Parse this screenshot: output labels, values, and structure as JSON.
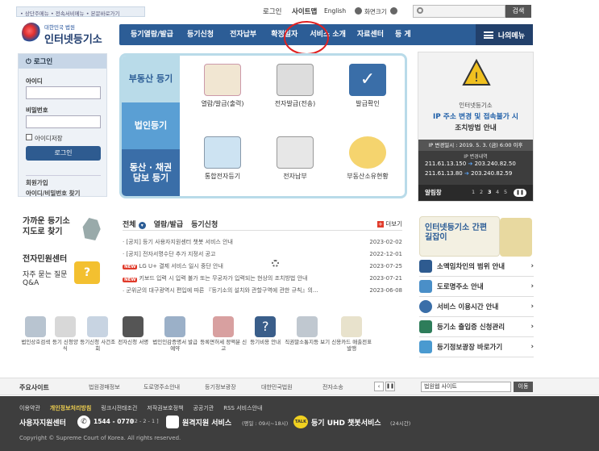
{
  "top_strip": "• 상단주메뉴  • 전속서비메뉴  • 본문바로가기",
  "utility": {
    "login": "로그인",
    "sitemap": "사이트맵",
    "english": "English",
    "zoom": "화면크기",
    "search_button": "검색"
  },
  "logo": {
    "court": "대한민국 법원",
    "name": "인터넷등기소"
  },
  "gnb": [
    "등기열람/발급",
    "등기신청",
    "전자납부",
    "확정일자",
    "서비스 소개",
    "자료센터",
    "등 게"
  ],
  "gnb_my": "나의메뉴",
  "login": {
    "title": "로그인",
    "id_label": "아이디",
    "pw_label": "비밀번호",
    "save_label": "아이디저장",
    "button": "로그인",
    "join": "회원가입",
    "find": "아이디/비밀번호 찾기"
  },
  "quick": {
    "label_realestate": "부동산 등기",
    "label_corp": "법인등기",
    "label_movable": "동산 · 채권 담보 등기",
    "items": [
      "열람/발급(출력)",
      "전자발급(전송)",
      "발급확인",
      "통합전자등기",
      "전자납부",
      "부동산소유현황"
    ]
  },
  "banner": {
    "brand": "인터넷등기소",
    "title1": "IP 주소 변경 및 접속불가 시",
    "title2": "조치방법 안내",
    "date": "IP 변경일시 : 2019. 5. 3. (금) 6:00 이후",
    "detail_label": "IP 변경내역",
    "row1_from": "211.61.13.150",
    "row1_to": "203.240.82.50",
    "row2_from": "211.61.13.80",
    "row2_to": "203.240.82.59",
    "alarm": "알림창",
    "pages": [
      "1",
      "2",
      "3",
      "4",
      "5"
    ]
  },
  "left_links": {
    "map_title": "가까운 등기소 지도로 찾기",
    "center_title": "전자민원센터",
    "qa": "자주 묻는 질문 Q&A"
  },
  "notice": {
    "tabs": [
      "전체",
      "열람/발급",
      "등기신청"
    ],
    "more": "더보기",
    "rows": [
      {
        "title": "[공지] 등기 사용자지원센터 챗봇 서비스 안내",
        "date": "2023-02-02",
        "new": ""
      },
      {
        "title": "[공지] 전자서명수단 추가 지정서 공고",
        "date": "2022-12-01",
        "new": ""
      },
      {
        "title": "LG U+ 결제 서비스 일시 중단 안내",
        "date": "2023-07-25",
        "new": "NEW"
      },
      {
        "title": "키보드 입력 시 입력 불가 또는 무궁자가 입력되는 현상의 조치방법 안내",
        "date": "2023-07-21",
        "new": "NEW"
      },
      {
        "title": "군위군의 대구광역시 편입에 따른 『등기소의 설치와 관할구역에 관한 규칙』의...",
        "date": "2023-06-08",
        "new": ""
      }
    ]
  },
  "svc": {
    "banner_title": "인터넷등기소 간편길잡이",
    "items": [
      "소액임차인의 범위 안내",
      "도로명주소 안내",
      "서비스 이용시간 안내",
      "등기소 출입증 신청관리",
      "등기정보광장 바로가기"
    ]
  },
  "icons": [
    "법인상호검색",
    "등기 신청양식",
    "등기신청 사건조회",
    "전자신청 서명",
    "법인인감증명서 발급예약",
    "등록면허세 정액분 신고",
    "등기비용 안내",
    "직권말소통지등 보기",
    "신용카드 매출전표 발행"
  ],
  "sitebar": {
    "label": "주요사이트",
    "sites": [
      "법원경매정보",
      "도로명주소안내",
      "등기정보광장",
      "대한민국법원",
      "전자소송"
    ],
    "select": "법원웹 사이트",
    "go": "이동"
  },
  "footer": {
    "links": [
      "이용약관",
      "개인정보처리방침",
      "링크시전태조건",
      "저작권보호정책",
      "공공기관",
      "RSS 서비스안내"
    ],
    "center": "사용자지원센터",
    "phone": "1544 - 0770",
    "phone_sub": "[ 82 - 2 - 1 ]",
    "remote": "원격지원 서비스",
    "remote_sub": "(평일 : 09시~18시)",
    "chat": "등기 UHD 챗봇서비스",
    "chat_sub": "(24시간)",
    "copyright": "Copyright © Supreme Court of Korea. All rights reserved."
  }
}
